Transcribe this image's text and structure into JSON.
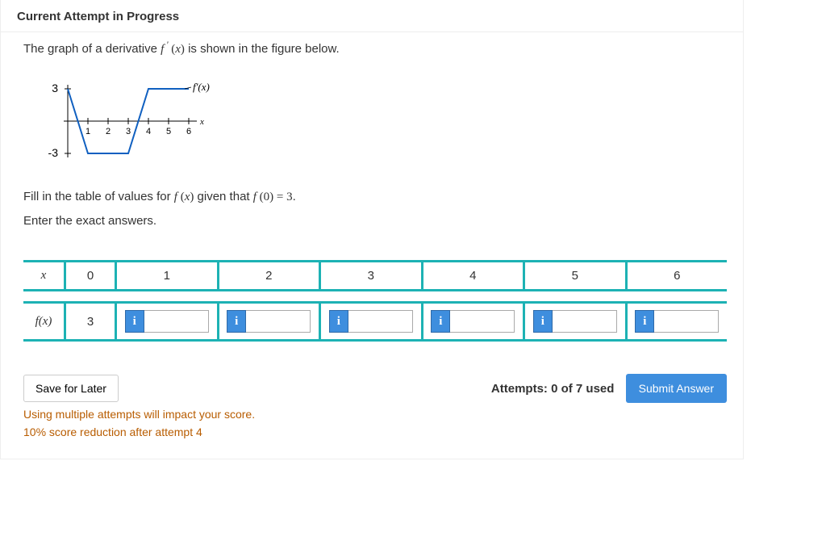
{
  "header": "Current Attempt in Progress",
  "prompt_a": "The graph of a derivative ",
  "prompt_b": " is shown in the figure below.",
  "instruction_a": "Fill in the table of values for ",
  "instruction_b": " given that ",
  "instruction_c": ".",
  "instruction2": "Enter the exact answers.",
  "row1_label": "x",
  "row2_label": "f(x)",
  "f0_value": "3",
  "cols": [
    "0",
    "1",
    "2",
    "3",
    "4",
    "5",
    "6"
  ],
  "save_label": "Save for Later",
  "attempts_text": "Attempts: 0 of 7 used",
  "submit_label": "Submit Answer",
  "warn_line1": "Using multiple attempts will impact your score.",
  "warn_line2": "10% score reduction after attempt 4",
  "chart_data": {
    "type": "line",
    "title": "",
    "curve_label": "f'(x)",
    "x_axis_label": "x",
    "x_ticks": [
      1,
      2,
      3,
      4,
      5,
      6
    ],
    "y_ticks": [
      -3,
      3
    ],
    "xlim": [
      0,
      6.5
    ],
    "ylim": [
      -3.5,
      3.5
    ],
    "series": [
      {
        "name": "f'(x)",
        "points": [
          [
            0,
            3
          ],
          [
            1,
            -3
          ],
          [
            3,
            -3
          ],
          [
            4,
            3
          ],
          [
            6,
            3
          ]
        ]
      }
    ]
  }
}
